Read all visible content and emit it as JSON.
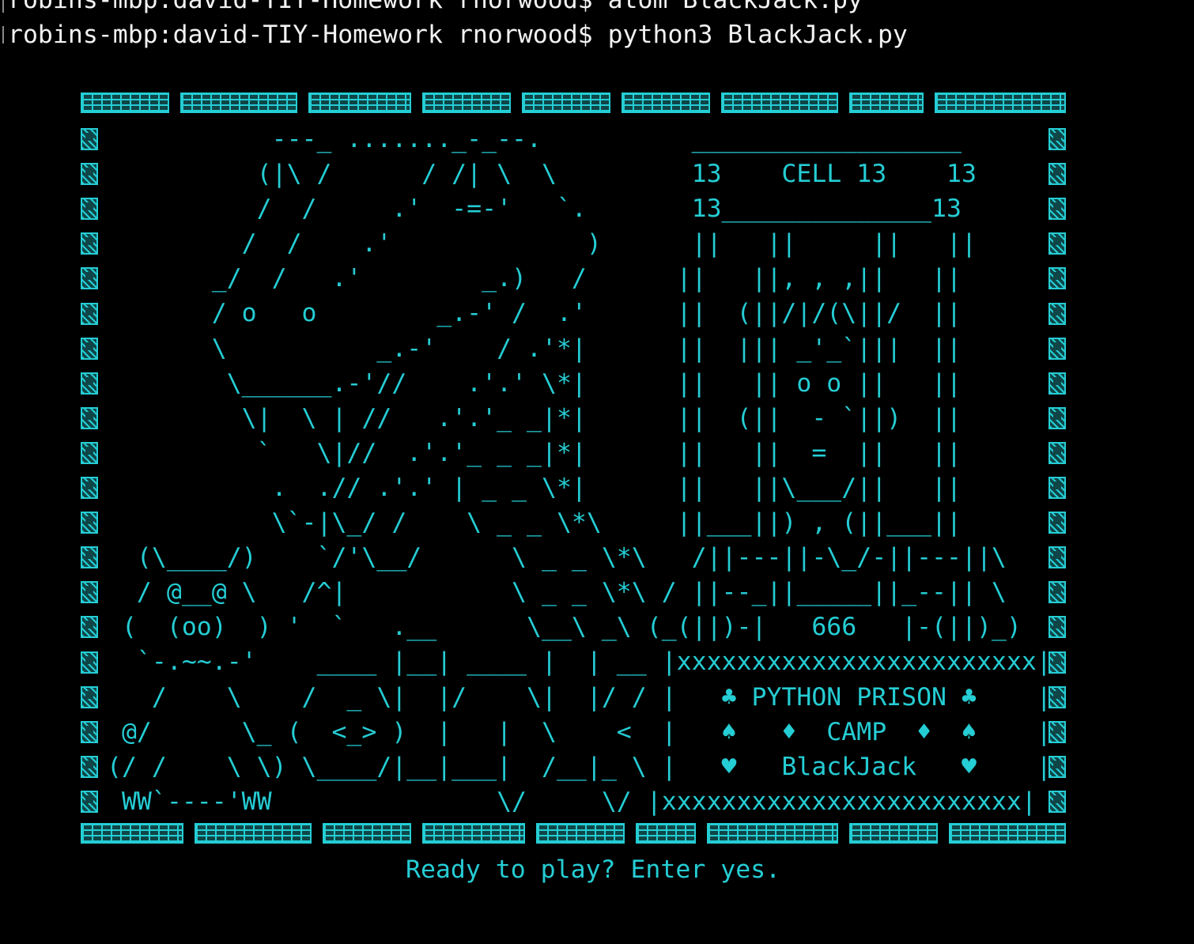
{
  "terminal": {
    "previous_command_line": "robins-mbp:david-TIY-Homework rnorwood$ atom BlackJack.py",
    "current_command_line": "robins-mbp:david-TIY-Homework rnorwood$ python3 BlackJack.py",
    "text_color": "#f2f2f2",
    "background": "#000000"
  },
  "program": {
    "accent_color": "#25cdd4",
    "border_icon": "playing-card-icon",
    "ascii_art_lines": [
      "           ---_ ......._-_--.          __________________",
      "          (|\\ /      / /| \\  \\         13    CELL 13    13",
      "          /  /     .'  -=-'   `.       13______________13",
      "         /  /    .'             )      ||   ||     ||   ||",
      "       _/  /   .'        _.)   /      ||   ||, , ,||   ||",
      "       / o   o        _.-' /  .'      ||  (||/|/(\\||/  ||",
      "       \\          _.-'    / .'*|      ||  ||| _'_`|||  ||",
      "        \\______.-'//    .'.' \\*|      ||   || o o ||   ||",
      "         \\|  \\ | //   .'.'_ _|*|      ||  (||  - `||)  ||",
      "          `   \\|//  .'.'_ _ _|*|      ||   ||  =  ||   ||",
      "           .  .// .'.' | _ _ \\*|      ||   ||\\___/||   ||",
      "           \\`-|\\_/ /    \\ _ _ \\*\\     ||___||) , (||___||",
      "  (\\____/)    `/'\\__/      \\ _ _ \\*\\   /||---||-\\_/-||---||\\",
      "  / @__@ \\   /^|           \\ _ _ \\*\\ / ||--_||_____||_--|| \\",
      " (  (oo)  ) '  `   .__      \\__\\ _\\ (_(||)-|   666   |-(||)_)",
      "  `-.~~.-'    ____ |__| ____ |  | __ |xxxxxxxxxxxxxxxxxxxxxxxx|",
      "   /    \\    /  _ \\|  |/    \\|  |/ / |   ♣ PYTHON PRISON ♣    |",
      " @/      \\_ (  <_> )  |   |  \\    <  |   ♠   ♦  CAMP  ♦  ♠    |",
      "(/ /    \\ \\) \\____/|__|___|  /__|_ \\ |   ♥   BlackJack   ♥    |",
      " WW`----'WW               \\/     \\/ |xxxxxxxxxxxxxxxxxxxxxxxx|"
    ],
    "ready_prompt": "Ready to play? Enter yes."
  }
}
